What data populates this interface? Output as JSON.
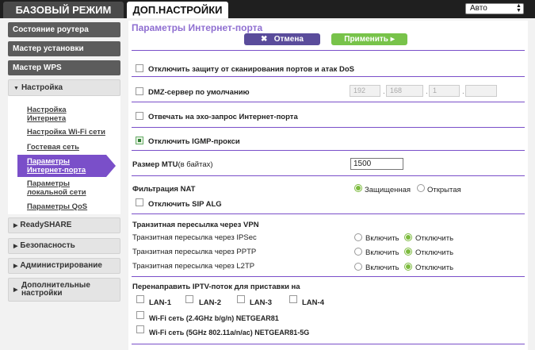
{
  "tabs": {
    "basic": "БАЗОВЫЙ РЕЖИМ",
    "advanced": "ДОП.НАСТРОЙКИ"
  },
  "language": {
    "value": "Авто"
  },
  "sidebar": {
    "router_status": "Состояние роутера",
    "setup_wizard": "Мастер установки",
    "wps_wizard": "Мастер WPS",
    "setup_group": "Настройка",
    "setup_items": [
      {
        "label": "Настройка\nИнтернета"
      },
      {
        "label": "Настройка Wi-Fi сети"
      },
      {
        "label": "Гостевая сеть"
      },
      {
        "label": "Параметры\nИнтернет-порта"
      },
      {
        "label": "Параметры\nлокальной сети"
      },
      {
        "label": "Параметры QoS"
      }
    ],
    "readyshare": "ReadySHARE",
    "security": "Безопасность",
    "administration": "Администрирование",
    "advanced": "Дополнительные\nнастройки"
  },
  "page": {
    "title": "Параметры Интернет-порта",
    "cancel": "Отмена",
    "apply": "Применить",
    "dos_label": "Отключить защиту от сканирования портов и атак DoS",
    "dmz_label": "DMZ-сервер по умолчанию",
    "dmz_ip": [
      "192",
      "168",
      "1",
      ""
    ],
    "ping_label": "Отвечать на эхо-запрос Интернет-порта",
    "igmp_label": "Отключить IGMP-прокси",
    "mtu_label": "Размер MTU",
    "mtu_unit": "(в байтах)",
    "mtu_value": "1500",
    "nat_label": "Фильтрация NAT",
    "nat_secured": "Защищенная",
    "nat_open": "Открытая",
    "sip_label": "Отключить SIP ALG",
    "vpn_title": "Транзитная пересылка через VPN",
    "vpn_rows": [
      {
        "label": "Транзитная пересылка через IPSec",
        "enable": "Включить",
        "disable": "Отключить"
      },
      {
        "label": "Транзитная пересылка через PPTP",
        "enable": "Включить",
        "disable": "Отключить"
      },
      {
        "label": "Транзитная пересылка через L2TP",
        "enable": "Включить",
        "disable": "Отключить"
      }
    ],
    "iptv_title": "Перенаправить IPTV-поток для приставки на",
    "lan_ports": [
      "LAN-1",
      "LAN-2",
      "LAN-3",
      "LAN-4"
    ],
    "wifi_24": "Wi-Fi сеть (2.4GHz b/g/n) NETGEAR81",
    "wifi_5": "Wi-Fi сеть (5GHz 802.11a/n/ac)  NETGEAR81-5G"
  }
}
